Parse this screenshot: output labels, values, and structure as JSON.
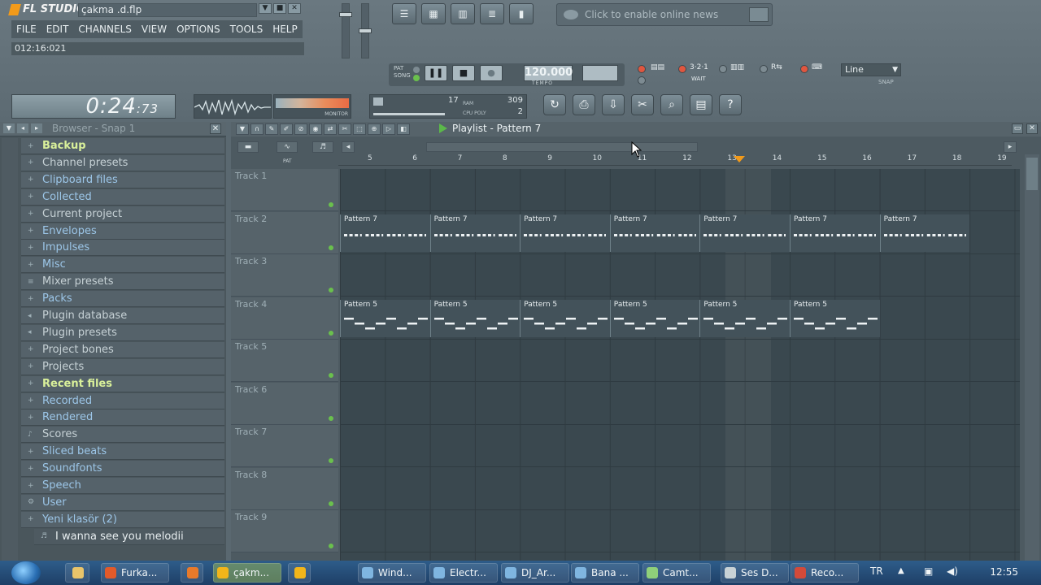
{
  "app": {
    "name": "FL STUDIO",
    "filename": "çakma .d.flp",
    "hint_text": "012:16:021",
    "menu": [
      "FILE",
      "EDIT",
      "CHANNELS",
      "VIEW",
      "OPTIONS",
      "TOOLS",
      "HELP"
    ],
    "window_buttons": [
      "▼",
      "■",
      "✕"
    ]
  },
  "news": {
    "text": "Click to enable online news"
  },
  "transport": {
    "mode_pat": "PAT",
    "mode_song": "SONG",
    "tempo": "120.000",
    "tempo_label": "TEMPO",
    "pat_label": "PAT",
    "snap_mode": "Line",
    "snap_label": "SNAP"
  },
  "clock": {
    "main": "0:24",
    "sub": ":73"
  },
  "monitor_label": "MONITOR",
  "cpu": {
    "ram": "17",
    "value": "309",
    "poly": "2",
    "ram_label": "RAM",
    "cpu_label": "CPU",
    "poly_label": "POLY"
  },
  "browser": {
    "title": "Browser - Snap 1",
    "items": [
      {
        "label": "Backup",
        "style": "bright",
        "icon": "+"
      },
      {
        "label": "Channel presets",
        "style": "normal",
        "icon": "+"
      },
      {
        "label": "Clipboard files",
        "style": "blue",
        "icon": "+"
      },
      {
        "label": "Collected",
        "style": "blue",
        "icon": "+"
      },
      {
        "label": "Current project",
        "style": "normal",
        "icon": "+"
      },
      {
        "label": "Envelopes",
        "style": "blue",
        "icon": "+"
      },
      {
        "label": "Impulses",
        "style": "blue",
        "icon": "+"
      },
      {
        "label": "Misc",
        "style": "blue",
        "icon": "+"
      },
      {
        "label": "Mixer presets",
        "style": "normal",
        "icon": "≡"
      },
      {
        "label": "Packs",
        "style": "blue",
        "icon": "+"
      },
      {
        "label": "Plugin database",
        "style": "normal",
        "icon": "◂"
      },
      {
        "label": "Plugin presets",
        "style": "normal",
        "icon": "◂"
      },
      {
        "label": "Project bones",
        "style": "normal",
        "icon": "+"
      },
      {
        "label": "Projects",
        "style": "normal",
        "icon": "+"
      },
      {
        "label": "Recent files",
        "style": "bright",
        "icon": "+"
      },
      {
        "label": "Recorded",
        "style": "blue",
        "icon": "+"
      },
      {
        "label": "Rendered",
        "style": "blue",
        "icon": "+"
      },
      {
        "label": "Scores",
        "style": "normal",
        "icon": "♪"
      },
      {
        "label": "Sliced beats",
        "style": "blue",
        "icon": "+"
      },
      {
        "label": "Soundfonts",
        "style": "blue",
        "icon": "+"
      },
      {
        "label": "Speech",
        "style": "blue",
        "icon": "+"
      },
      {
        "label": "User",
        "style": "blue",
        "icon": "⚙"
      },
      {
        "label": "Yeni klasör (2)",
        "style": "blue",
        "icon": "+"
      },
      {
        "label": "I wanna see you melodii",
        "style": "sub",
        "icon": "♬"
      }
    ]
  },
  "playlist": {
    "title": "Playlist - Pattern 7",
    "pat_label": "PAT",
    "ruler": [
      "5",
      "6",
      "7",
      "8",
      "9",
      "10",
      "11",
      "12",
      "13",
      "14",
      "15",
      "16",
      "17",
      "18",
      "19"
    ],
    "tracks": [
      "Track 1",
      "Track 2",
      "Track 3",
      "Track 4",
      "Track 5",
      "Track 6",
      "Track 7",
      "Track 8",
      "Track 9"
    ],
    "pattern7_label": "Pattern 7",
    "pattern5_label": "Pattern 5"
  },
  "taskbar": {
    "items": [
      {
        "label": "Furka...",
        "color": "#e25a2a"
      },
      {
        "label": "çakm...",
        "color": "#f2b51a",
        "active": true
      },
      {
        "label": "Wind...",
        "color": "#7fb5e0"
      },
      {
        "label": "Electr...",
        "color": "#7fb5e0"
      },
      {
        "label": "DJ_Ar...",
        "color": "#7fb5e0"
      },
      {
        "label": "Bana ...",
        "color": "#7fb5e0"
      },
      {
        "label": "Camt...",
        "color": "#8fcf7a"
      },
      {
        "label": "Ses D...",
        "color": "#c8d2d6"
      },
      {
        "label": "Reco...",
        "color": "#d24a3a"
      }
    ],
    "lang": "TR",
    "time": "12:55"
  }
}
